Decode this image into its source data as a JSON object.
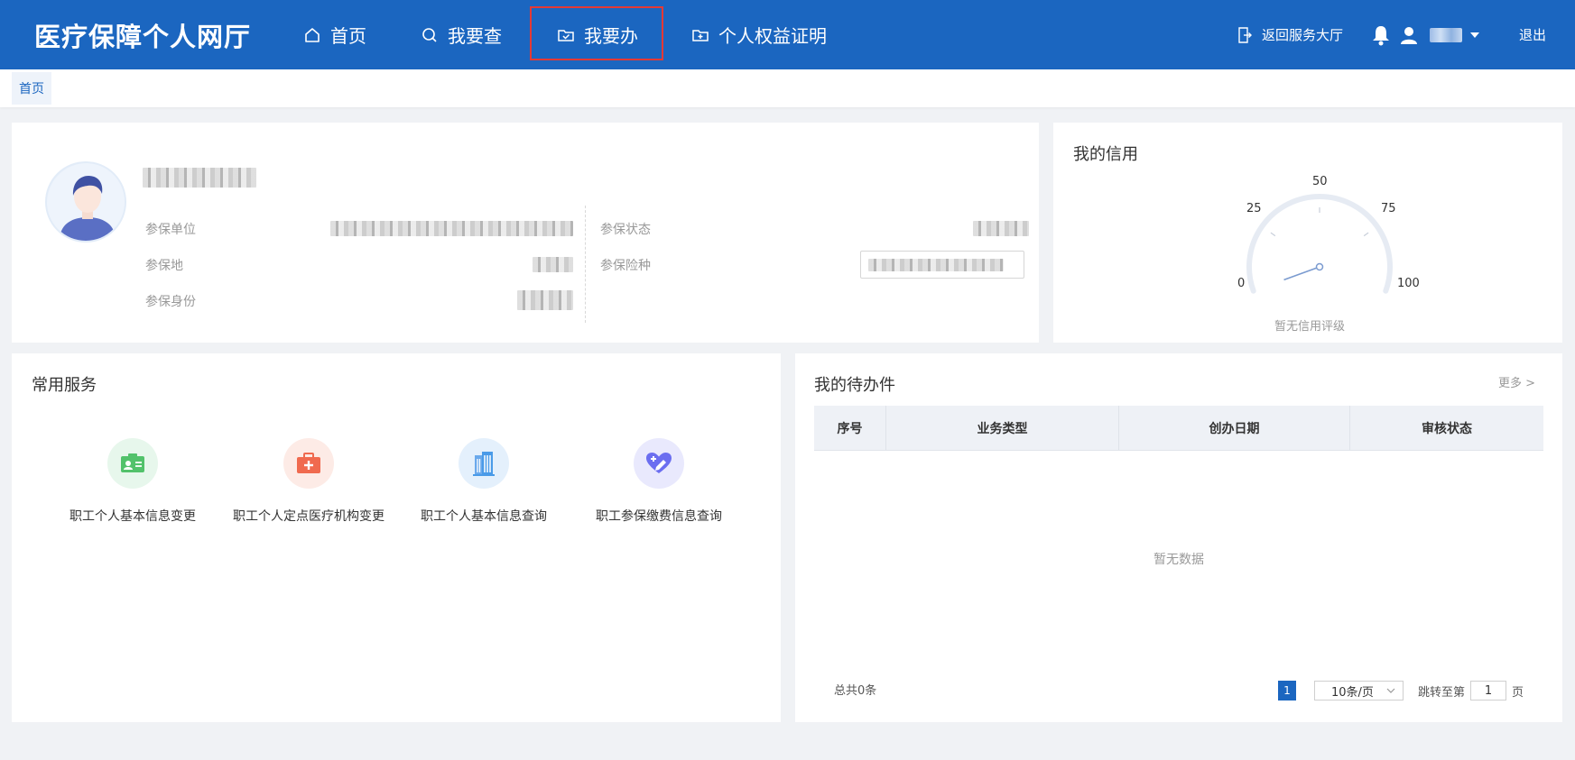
{
  "header": {
    "logo": "医疗保障个人网厅",
    "nav": [
      "首页",
      "我要查",
      "我要办",
      "个人权益证明"
    ],
    "return_label": "返回服务大厅",
    "logout_label": "退出"
  },
  "tabs": {
    "home": "首页"
  },
  "profile": {
    "labels": {
      "unit": "参保单位",
      "region": "参保地",
      "identity": "参保身份",
      "status": "参保状态",
      "insurance_type": "参保险种"
    }
  },
  "credit": {
    "title": "我的信用",
    "ticks": [
      "0",
      "25",
      "50",
      "75",
      "100"
    ],
    "no_rating": "暂无信用评级",
    "gauge_value": 0
  },
  "services": {
    "title": "常用服务",
    "items": [
      {
        "label": "职工个人基本信息变更",
        "icon": "id-card-icon",
        "color": "#52c26b",
        "bg": "#e7f7ec"
      },
      {
        "label": "职工个人定点医疗机构变更",
        "icon": "medical-kit-icon",
        "color": "#f06a4f",
        "bg": "#fdebe6"
      },
      {
        "label": "职工个人基本信息查询",
        "icon": "building-icon",
        "color": "#4a9be8",
        "bg": "#e4f0fc"
      },
      {
        "label": "职工参保缴费信息查询",
        "icon": "heart-edit-icon",
        "color": "#6b6ef0",
        "bg": "#e9e9fd"
      }
    ]
  },
  "todo": {
    "title": "我的待办件",
    "more": "更多 >",
    "columns": [
      "序号",
      "业务类型",
      "创办日期",
      "审核状态"
    ],
    "empty": "暂无数据",
    "total": "总共0条",
    "current_page": "1",
    "page_size": "10条/页",
    "jump_label": "跳转至第",
    "jump_value": "1",
    "page_unit": "页"
  }
}
